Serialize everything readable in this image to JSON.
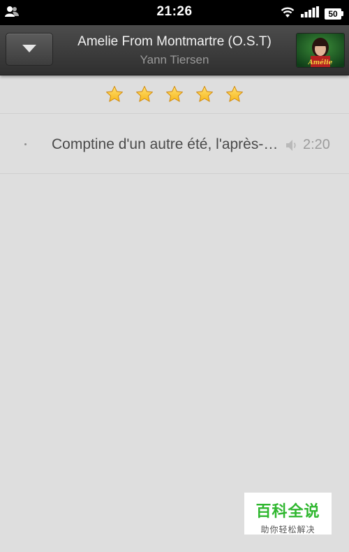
{
  "status_bar": {
    "time": "21:26",
    "battery": "50"
  },
  "header": {
    "album_title": "Amelie From Montmartre (O.S.T)",
    "artist": "Yann Tiersen",
    "dropdown_icon": "caret-down-icon",
    "album_art_text": "Amélie"
  },
  "rating": {
    "value": 5,
    "max": 5,
    "star_color": "#f7b81c"
  },
  "tracks": [
    {
      "title": "Comptine d'un autre été, l'après-midi",
      "duration": "2:20",
      "playing_icon": "speaker-icon"
    }
  ],
  "watermark": {
    "title": "百科全说",
    "subtitle": "助你轻松解决"
  }
}
